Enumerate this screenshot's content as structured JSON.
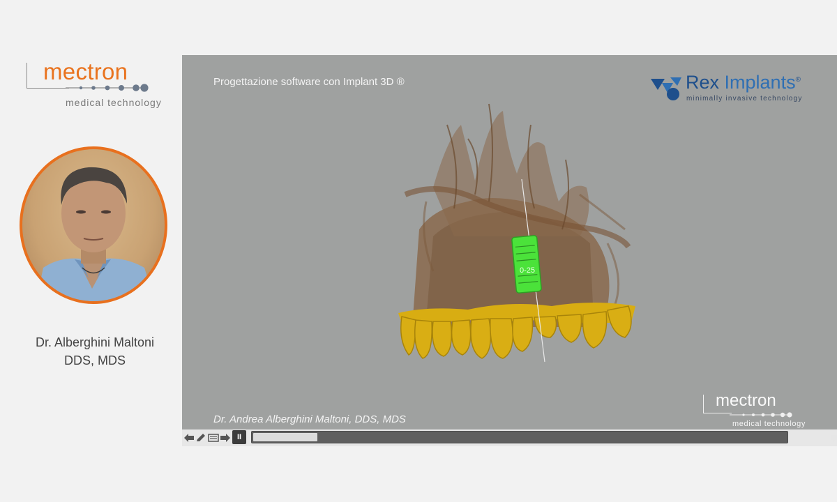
{
  "left_panel": {
    "logo": {
      "word": "mectron",
      "tagline": "medical technology"
    },
    "presenter": {
      "name_line1": "Dr. Alberghini Maltoni",
      "name_line2": "DDS, MDS"
    }
  },
  "video": {
    "title": "Progettazione software con Implant 3D ®",
    "brand_logo": {
      "name_bold": "Rex",
      "name_light": "Implants",
      "reg": "®",
      "tagline": "minimally invasive technology"
    },
    "implant_label": "0-25",
    "caption": "Dr. Andrea Alberghini Maltoni, DDS, MDS",
    "watermark": {
      "word": "mectron",
      "tagline": "medical technology"
    }
  },
  "controls": {
    "pause_label": "II",
    "progress": 0.12
  },
  "colors": {
    "accent_orange": "#e9731e",
    "rex_blue": "#1e4f8c",
    "video_bg": "#9fa1a0",
    "tooth_yellow": "#d8ad12",
    "implant_green": "#4be23a"
  },
  "icons": [
    "back-arrow-icon",
    "pencil-icon",
    "menu-icon",
    "forward-arrow-icon",
    "pause-icon",
    "chat-icon",
    "volume-icon"
  ]
}
